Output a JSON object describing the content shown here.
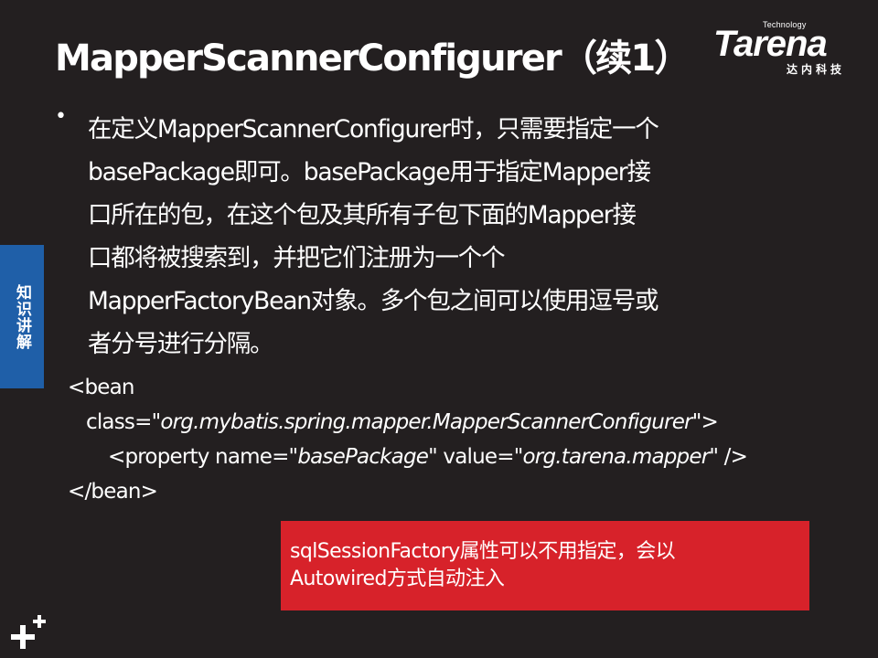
{
  "slide": {
    "title": "MapperScannerConfigurer（续1）",
    "logo": {
      "small_text": "Technology",
      "brand": "Tarena",
      "subtitle": "达内科技"
    },
    "side_tab": "知识讲解",
    "bullet_text": "在定义MapperScannerConfigurer时，只需要指定一个\nbasePackage即可。basePackage用于指定Mapper接\n口所在的包，在这个包及其所有子包下面的Mapper接\n口都将被搜索到，并把它们注册为一个个\nMapperFactoryBean对象。多个包之间可以使用逗号或\n者分号进行分隔。",
    "code": {
      "line1": "<bean",
      "line2_prefix": "class=\"",
      "line2_value": "org.mybatis.spring.mapper.MapperScannerConfigurer",
      "line2_suffix": "\">",
      "line3_prefix": "<property name=\"",
      "line3_name": "basePackage",
      "line3_mid": "\" value=\"",
      "line3_value": "org.tarena.mapper",
      "line3_suffix": "\" />",
      "line4": "</bean>"
    },
    "note": "sqlSessionFactory属性可以不用指定，会以\nAutowired方式自动注入"
  },
  "colors": {
    "background": "#231f20",
    "side_tab": "#1f5fa8",
    "note_box": "#d7222a",
    "text": "#ffffff"
  },
  "icons": {
    "bullet": "bullet-dot",
    "corner": "plus-icon"
  }
}
